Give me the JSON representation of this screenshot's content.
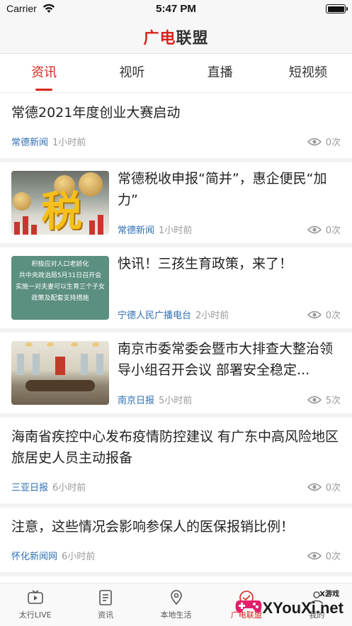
{
  "status_bar": {
    "carrier": "Carrier",
    "time": "5:47 PM"
  },
  "header": {
    "logo_part1": "广电",
    "logo_part2": "联盟"
  },
  "tabs": [
    {
      "label": "资讯",
      "active": true
    },
    {
      "label": "视听",
      "active": false
    },
    {
      "label": "直播",
      "active": false
    },
    {
      "label": "短视频",
      "active": false
    }
  ],
  "feed": [
    {
      "title": "常德2021年度创业大赛启动",
      "source": "常德新闻",
      "time": "1小时前",
      "views": "0次"
    },
    {
      "title": "常德税收申报“简并”，惠企便民“加力”",
      "source": "常德新闻",
      "time": "1小时前",
      "views": "0次",
      "thumb_char": "税"
    },
    {
      "title": "快讯！三孩生育政策，来了！",
      "source": "宁德人民广播电台",
      "time": "2小时前",
      "views": "0次",
      "thumb_lines": [
        "积极应对人口老龄化",
        "共中央政治局5月31日召开会",
        "实施一对夫妻可以生育三个子女",
        "政策及配套支持措施"
      ]
    },
    {
      "title": "南京市委常委会暨市大排查大整治领导小组召开会议 部署安全稳定...",
      "source": "南京日报",
      "time": "5小时前",
      "views": "5次"
    },
    {
      "title": "海南省疾控中心发布疫情防控建议 有广东中高风险地区旅居史人员主动报备",
      "source": "三亚日报",
      "time": "6小时前",
      "views": "0次"
    },
    {
      "title": "注意，这些情况会影响参保人的医保报销比例！",
      "source": "怀化新闻网",
      "time": "6小时前",
      "views": "0次"
    }
  ],
  "bottom_nav": [
    {
      "label": "太行LIVE",
      "icon": "tv-icon"
    },
    {
      "label": "资讯",
      "icon": "news-icon"
    },
    {
      "label": "本地生活",
      "icon": "location-icon"
    },
    {
      "label": "广电联盟",
      "icon": "alliance-icon",
      "active": true
    },
    {
      "label": "我的",
      "icon": "profile-icon"
    }
  ],
  "watermark": {
    "text": "XYouXi.net",
    "small": "X游戏"
  },
  "colors": {
    "accent": "#d9231c",
    "source_blue": "#2f6fb4"
  }
}
